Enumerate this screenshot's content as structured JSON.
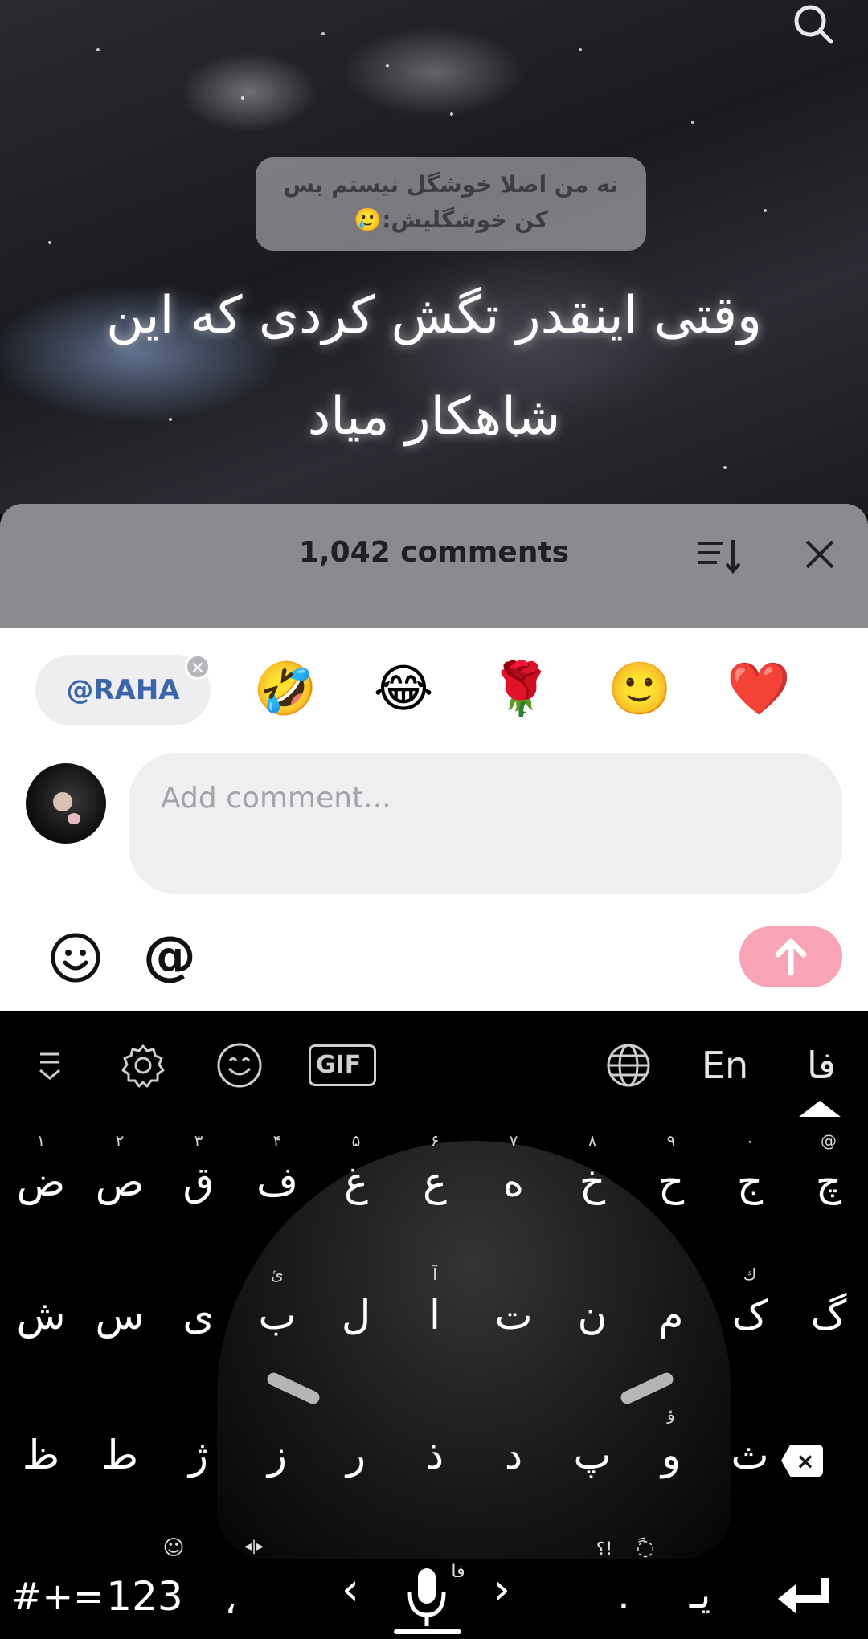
{
  "video": {
    "reply_bubble": "نه من اصلا خوشگل نیستم بس کن خوشگلیش:🥲",
    "caption": "وقتی اینقدر تگش کردی که این شاهکار میاد"
  },
  "comments_sheet": {
    "count_label": "1,042 comments"
  },
  "composer": {
    "mention_chip": "@RAHA",
    "quick_emojis": [
      "🤣",
      "😂",
      "🌹",
      "🙂",
      "❤️"
    ],
    "input_placeholder": "Add comment...",
    "input_value": "",
    "mention_button": "@"
  },
  "keyboard": {
    "toolbar": {
      "gif_label": "GIF",
      "english_label": "En",
      "persian_label": "فا"
    },
    "row1": [
      {
        "key": "ض",
        "hint": "۱"
      },
      {
        "key": "ص",
        "hint": "۲"
      },
      {
        "key": "ق",
        "hint": "۳"
      },
      {
        "key": "ف",
        "hint": "۴"
      },
      {
        "key": "غ",
        "hint": "۵"
      },
      {
        "key": "ع",
        "hint": "۶"
      },
      {
        "key": "ه",
        "hint": "۷"
      },
      {
        "key": "خ",
        "hint": "۸"
      },
      {
        "key": "ح",
        "hint": "۹"
      },
      {
        "key": "ج",
        "hint": "۰"
      },
      {
        "key": "چ",
        "hint": "@"
      }
    ],
    "row2": [
      {
        "key": "ش",
        "hint": ""
      },
      {
        "key": "س",
        "hint": ""
      },
      {
        "key": "ی",
        "hint": ""
      },
      {
        "key": "ب",
        "hint": "ئ"
      },
      {
        "key": "ل",
        "hint": ""
      },
      {
        "key": "ا",
        "hint": "آ"
      },
      {
        "key": "ت",
        "hint": ""
      },
      {
        "key": "ن",
        "hint": ""
      },
      {
        "key": "م",
        "hint": ""
      },
      {
        "key": "ک",
        "hint": "ك"
      },
      {
        "key": "گ",
        "hint": ""
      }
    ],
    "row3": [
      {
        "key": "ظ",
        "hint": ""
      },
      {
        "key": "ط",
        "hint": ""
      },
      {
        "key": "ژ",
        "hint": ""
      },
      {
        "key": "ز",
        "hint": ""
      },
      {
        "key": "ر",
        "hint": ""
      },
      {
        "key": "ذ",
        "hint": ""
      },
      {
        "key": "د",
        "hint": ""
      },
      {
        "key": "پ",
        "hint": ""
      },
      {
        "key": "و",
        "hint": "ؤ"
      },
      {
        "key": "ث",
        "hint": ""
      }
    ],
    "bottom": {
      "symbols": "#+=",
      "numbers": "123",
      "comma": "،",
      "left_arrow": "‹",
      "right_arrow": "›",
      "mic_hint": "فا",
      "period": ".",
      "zwnj": "یـ",
      "punct_hint": "؟!",
      "emoji_hint": "☺",
      "cursor_hint": "◂|▸"
    }
  },
  "colors": {
    "send_button": "#f9a4b6",
    "mention_chip_text": "#3c64a8",
    "sheet_header": "#8a8a8f"
  }
}
